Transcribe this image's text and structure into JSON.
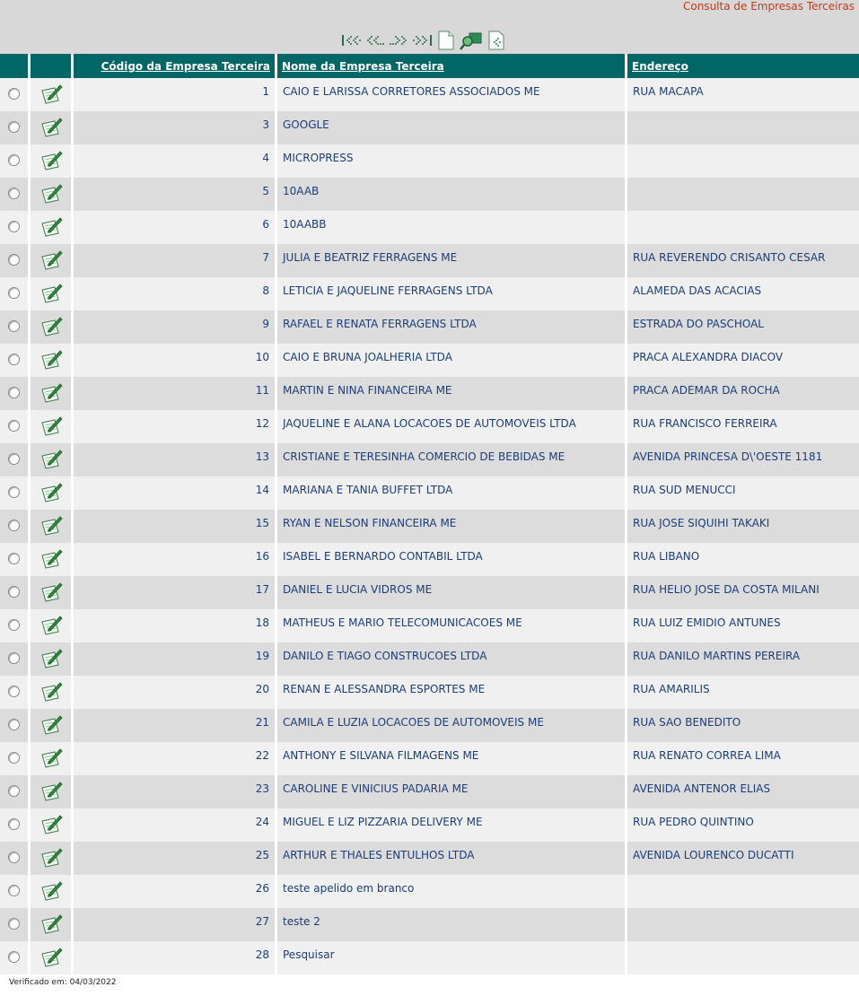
{
  "header": {
    "title": "Consulta de Empresas Terceiras"
  },
  "toolbar": {
    "icons": [
      "first-page-icon",
      "previous-page-icon",
      "next-page-icon",
      "last-page-icon",
      "new-document-icon",
      "search-icon",
      "export-icon"
    ]
  },
  "table": {
    "columns": {
      "codigo": "Código da Empresa Terceira",
      "nome": "Nome da Empresa Terceira",
      "endereco": "Endereço"
    },
    "rows": [
      {
        "codigo": "1",
        "nome": "CAIO E LARISSA CORRETORES ASSOCIADOS ME",
        "endereco": "RUA MACAPA"
      },
      {
        "codigo": "3",
        "nome": "GOOGLE",
        "endereco": ""
      },
      {
        "codigo": "4",
        "nome": "MICROPRESS",
        "endereco": ""
      },
      {
        "codigo": "5",
        "nome": "10AAB",
        "endereco": ""
      },
      {
        "codigo": "6",
        "nome": "10AABB",
        "endereco": ""
      },
      {
        "codigo": "7",
        "nome": "JULIA E BEATRIZ FERRAGENS ME",
        "endereco": "RUA REVERENDO CRISANTO CESAR"
      },
      {
        "codigo": "8",
        "nome": "LETICIA E JAQUELINE FERRAGENS LTDA",
        "endereco": "ALAMEDA DAS ACACIAS"
      },
      {
        "codigo": "9",
        "nome": "RAFAEL E RENATA FERRAGENS LTDA",
        "endereco": "ESTRADA DO PASCHOAL"
      },
      {
        "codigo": "10",
        "nome": "CAIO E BRUNA JOALHERIA LTDA",
        "endereco": "PRACA ALEXANDRA DIACOV"
      },
      {
        "codigo": "11",
        "nome": "MARTIN E NINA FINANCEIRA ME",
        "endereco": "PRACA ADEMAR DA ROCHA"
      },
      {
        "codigo": "12",
        "nome": "JAQUELINE E ALANA LOCACOES DE AUTOMOVEIS LTDA",
        "endereco": "RUA FRANCISCO FERREIRA"
      },
      {
        "codigo": "13",
        "nome": "CRISTIANE E TERESINHA COMERCIO DE BEBIDAS ME",
        "endereco": "AVENIDA PRINCESA D\\'OESTE 1181"
      },
      {
        "codigo": "14",
        "nome": "MARIANA E TANIA BUFFET LTDA",
        "endereco": "RUA SUD MENUCCI"
      },
      {
        "codigo": "15",
        "nome": "RYAN E NELSON FINANCEIRA ME",
        "endereco": "RUA JOSE SIQUIHI TAKAKI"
      },
      {
        "codigo": "16",
        "nome": "ISABEL E BERNARDO CONTABIL LTDA",
        "endereco": "RUA LIBANO"
      },
      {
        "codigo": "17",
        "nome": "DANIEL E LUCIA VIDROS ME",
        "endereco": "RUA HELIO JOSE DA COSTA MILANI"
      },
      {
        "codigo": "18",
        "nome": "MATHEUS E MARIO TELECOMUNICACOES ME",
        "endereco": "RUA LUIZ EMIDIO ANTUNES"
      },
      {
        "codigo": "19",
        "nome": "DANILO E TIAGO CONSTRUCOES LTDA",
        "endereco": "RUA DANILO MARTINS PEREIRA"
      },
      {
        "codigo": "20",
        "nome": "RENAN E ALESSANDRA ESPORTES ME",
        "endereco": "RUA AMARILIS"
      },
      {
        "codigo": "21",
        "nome": "CAMILA E LUZIA LOCACOES DE AUTOMOVEIS ME",
        "endereco": "RUA SAO BENEDITO"
      },
      {
        "codigo": "22",
        "nome": "ANTHONY E SILVANA FILMAGENS ME",
        "endereco": "RUA RENATO CORREA LIMA"
      },
      {
        "codigo": "23",
        "nome": "CAROLINE E VINICIUS PADARIA ME",
        "endereco": "AVENIDA ANTENOR ELIAS"
      },
      {
        "codigo": "24",
        "nome": "MIGUEL E LIZ PIZZARIA DELIVERY ME",
        "endereco": "RUA PEDRO QUINTINO"
      },
      {
        "codigo": "25",
        "nome": "ARTHUR E THALES ENTULHOS LTDA",
        "endereco": "AVENIDA LOURENCO DUCATTI"
      },
      {
        "codigo": "26",
        "nome": "teste apelido em branco",
        "endereco": ""
      },
      {
        "codigo": "27",
        "nome": "teste 2",
        "endereco": ""
      },
      {
        "codigo": "28",
        "nome": "Pesquisar",
        "endereco": ""
      }
    ]
  },
  "footer": {
    "verified": "Verificado em: 04/03/2022"
  },
  "colors": {
    "header_bg": "#006666",
    "title": "#c43a1a",
    "text": "#1a3d7a",
    "row_light": "#f0f0f0",
    "row_dark": "#dcdcdc"
  }
}
